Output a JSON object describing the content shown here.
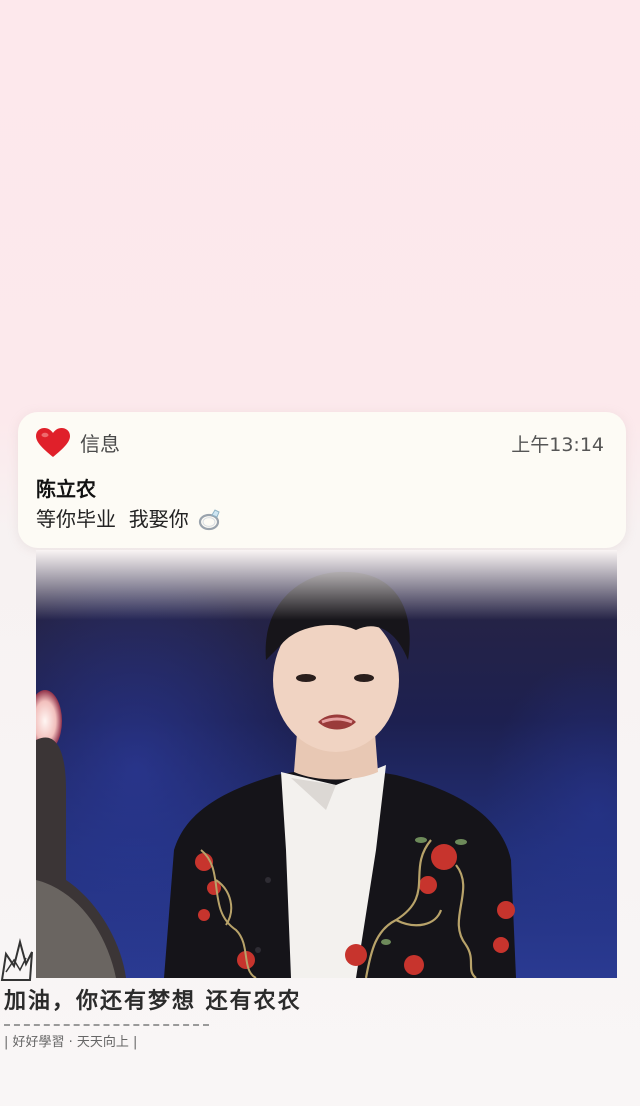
{
  "notification": {
    "app_icon": "red-heart-icon",
    "app_name": "信息",
    "time": "上午13:14",
    "sender": "陈立农",
    "message": "等你毕业  我娶你",
    "message_icon": "ring-icon"
  },
  "photo": {
    "description_icon": "photo-image"
  },
  "footer": {
    "slogan": "加油，你还有梦想 还有农农",
    "tagline": "| 好好學習 · 天天向上 |",
    "decoration_icon": "crown-icon"
  },
  "colors": {
    "background_top": "#fde8ec",
    "heart": "#e0202a",
    "card": "#fdfbf5"
  }
}
